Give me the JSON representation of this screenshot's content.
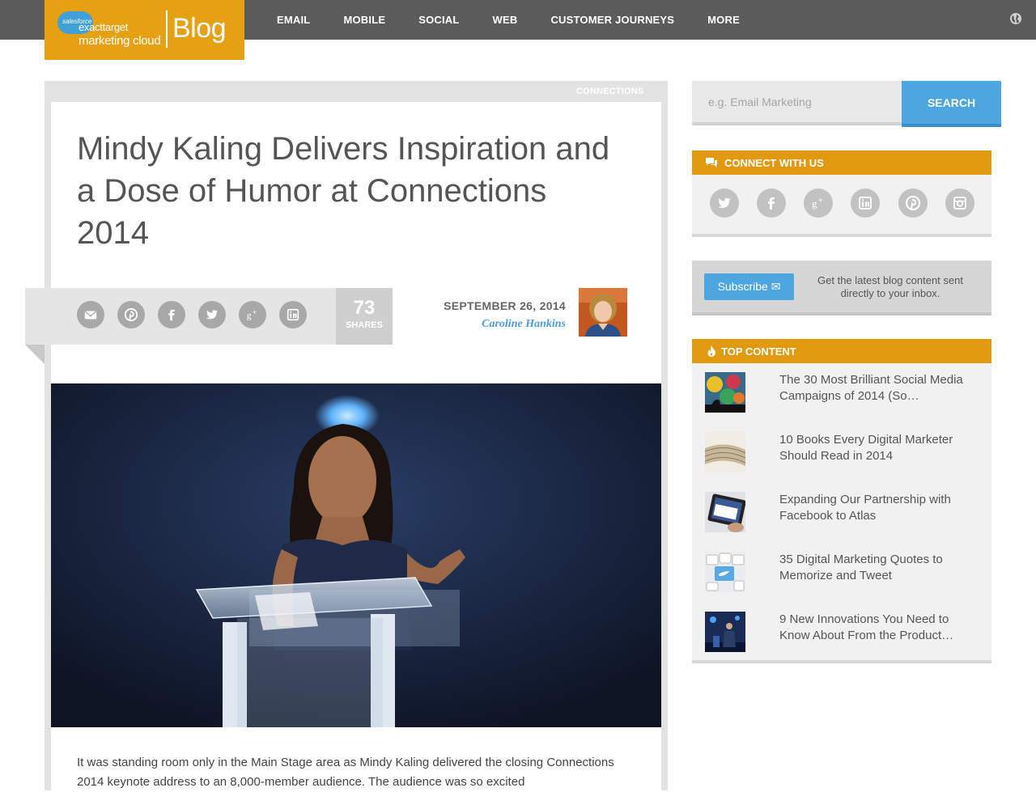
{
  "header": {
    "logo": {
      "salesforce": "salesforce",
      "line1": "exacttarget",
      "line2": "marketing cloud",
      "blog": "Blog"
    },
    "nav": [
      "EMAIL",
      "MOBILE",
      "SOCIAL",
      "WEB",
      "CUSTOMER JOURNEYS",
      "MORE"
    ],
    "globe_icon": "globe-icon"
  },
  "article": {
    "category": "CONNECTIONS",
    "title": "Mindy Kaling Delivers Inspiration and a Dose of Humor at Connections 2014",
    "share": {
      "icons": [
        "email-icon",
        "pinterest-icon",
        "facebook-icon",
        "twitter-icon",
        "google-plus-icon",
        "linkedin-icon"
      ],
      "count": "73",
      "count_label": "SHARES"
    },
    "date": "SEPTEMBER 26, 2014",
    "author": "Caroline Hankins",
    "body": "It was standing room only in the Main Stage area as Mindy Kaling delivered the closing Connections 2014 keynote address to an 8,000-member audience. The audience was so excited"
  },
  "sidebar": {
    "search": {
      "placeholder": "e.g. Email Marketing",
      "button": "SEARCH"
    },
    "connect": {
      "title": "CONNECT WITH US",
      "icons": [
        "twitter-icon",
        "facebook-icon",
        "google-plus-icon",
        "linkedin-icon",
        "pinterest-icon",
        "instagram-icon"
      ]
    },
    "subscribe": {
      "button": "Subscribe ✉",
      "text": "Get the latest blog content sent directly to your inbox."
    },
    "top_content": {
      "title": "TOP CONTENT",
      "items": [
        {
          "title": "The 30 Most Brilliant Social Media Campaigns of 2014 (So…"
        },
        {
          "title": "10 Books Every Digital Marketer Should Read in 2014"
        },
        {
          "title": "Expanding Our Partnership with Facebook to Atlas"
        },
        {
          "title": "35 Digital Marketing Quotes to Memorize and Tweet"
        },
        {
          "title": "9 New Innovations You Need to Know About From the Product…"
        }
      ]
    }
  },
  "colors": {
    "accent_orange": "#e19a10",
    "accent_blue": "#4ea6e0",
    "nav_bg": "#5b5b5b"
  }
}
